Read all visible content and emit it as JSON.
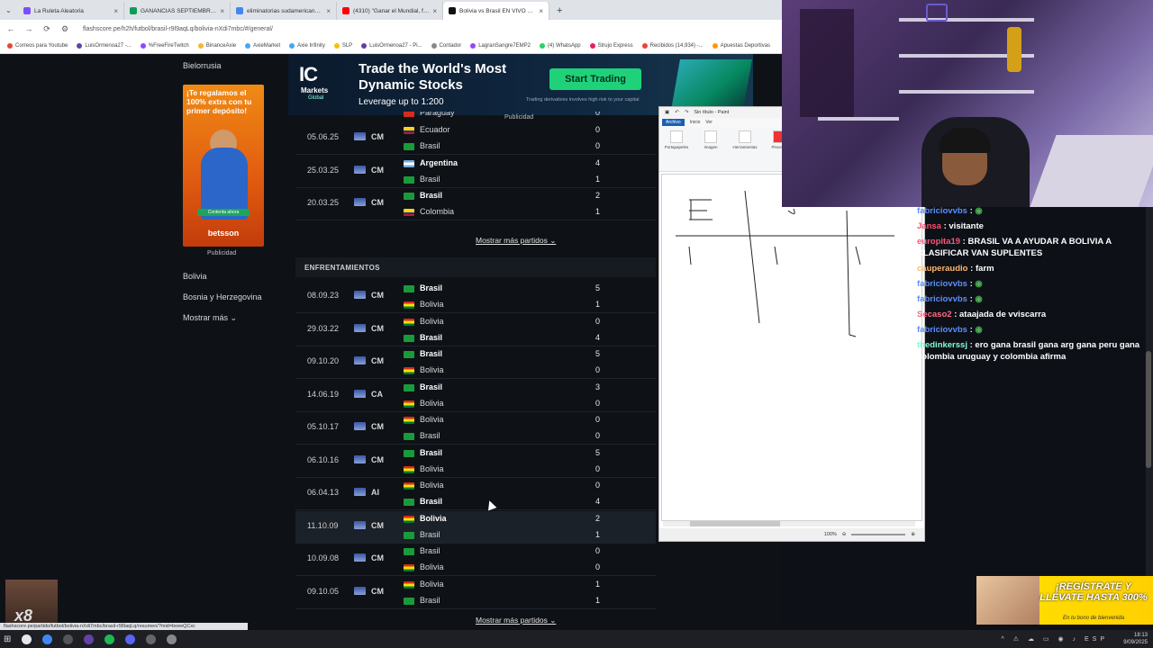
{
  "browser": {
    "tabs": [
      {
        "label": "La Ruleta Aleatoria",
        "color": "#7c4dff"
      },
      {
        "label": "GANANCIAS SEPTIEMBRE - Ho...",
        "color": "#0f9d58"
      },
      {
        "label": "eliminatorias sudamericanas -...",
        "color": "#4285f4"
      },
      {
        "label": "(4310) \"Ganar el Mundial, fina...",
        "color": "#ff0000"
      },
      {
        "label": "Bolivia vs Brasil EN VIVO 10/0...",
        "color": "#111111",
        "active": true
      }
    ],
    "new_tab": "+",
    "url": "flashscore.pe/h2h/futbol/brasil-r9l9aqLq/bolivia-nXdi7mbc/#/general/",
    "bookmarks": [
      "Correos para Youtube",
      "LuisOrmenoa27 -...",
      "%FreeFireTwitch",
      "BinanceAxie",
      "AxieMarket",
      "Axie Infinity",
      "SLP",
      "LuisOrmenoa27 - Pi...",
      "Contador",
      "LagranSangre7EMP2",
      "(4) WhatsApp",
      "Strujo Express",
      "Recibidos (14,934) -...",
      "Apuestas Deportivas"
    ]
  },
  "sidebar": {
    "top_link": "Bielorrusia",
    "promo_text": "¡Te regalamos el 100% extra con tu primer depósito!",
    "promo_brand": "betsson",
    "promo_cta": "Contenta ahora",
    "pub_label": "Publicidad",
    "links": [
      "Bolivia",
      "Bosnia y Herzegovina"
    ],
    "more": "Mostrar más"
  },
  "ad": {
    "logo": "IC",
    "logo_sub": "Markets",
    "logo_sub2": "Global",
    "headline": "Trade the World's Most Dynamic Stocks",
    "subline": "Leverage up to 1:200",
    "cta": "Start Trading",
    "risk": "Trading derivatives involves high risk to your capital",
    "pub_label": "Publicidad"
  },
  "matches_top": [
    {
      "date": "",
      "comp": "",
      "home": "Paraguay",
      "away": "",
      "hs": "0",
      "as": "",
      "partial": true
    },
    {
      "date": "05.06.25",
      "comp": "CM",
      "home": "Ecuador",
      "home_flag": "ecu",
      "away": "Brasil",
      "away_flag": "bra",
      "hs": "0",
      "as": "0",
      "winner": ""
    },
    {
      "date": "25.03.25",
      "comp": "CM",
      "home": "Argentina",
      "home_flag": "arg",
      "away": "Brasil",
      "away_flag": "bra",
      "hs": "4",
      "as": "1",
      "winner": "home"
    },
    {
      "date": "20.03.25",
      "comp": "CM",
      "home": "Brasil",
      "home_flag": "bra",
      "away": "Colombia",
      "away_flag": "col",
      "hs": "2",
      "as": "1",
      "winner": "home"
    }
  ],
  "more_matches": "Mostrar más partidos",
  "section_title": "ENFRENTAMIENTOS",
  "h2h": [
    {
      "date": "08.09.23",
      "comp": "CM",
      "home": "Brasil",
      "home_flag": "bra",
      "away": "Bolivia",
      "away_flag": "bol",
      "hs": "5",
      "as": "1",
      "winner": "home"
    },
    {
      "date": "29.03.22",
      "comp": "CM",
      "home": "Bolivia",
      "home_flag": "bol",
      "away": "Brasil",
      "away_flag": "bra",
      "hs": "0",
      "as": "4",
      "winner": "away"
    },
    {
      "date": "09.10.20",
      "comp": "CM",
      "home": "Brasil",
      "home_flag": "bra",
      "away": "Bolivia",
      "away_flag": "bol",
      "hs": "5",
      "as": "0",
      "winner": "home"
    },
    {
      "date": "14.06.19",
      "comp": "CA",
      "home": "Brasil",
      "home_flag": "bra",
      "away": "Bolivia",
      "away_flag": "bol",
      "hs": "3",
      "as": "0",
      "winner": "home"
    },
    {
      "date": "05.10.17",
      "comp": "CM",
      "home": "Bolivia",
      "home_flag": "bol",
      "away": "Brasil",
      "away_flag": "bra",
      "hs": "0",
      "as": "0",
      "winner": ""
    },
    {
      "date": "06.10.16",
      "comp": "CM",
      "home": "Brasil",
      "home_flag": "bra",
      "away": "Bolivia",
      "away_flag": "bol",
      "hs": "5",
      "as": "0",
      "winner": "home"
    },
    {
      "date": "06.04.13",
      "comp": "AI",
      "home": "Bolivia",
      "home_flag": "bol",
      "away": "Brasil",
      "away_flag": "bra",
      "hs": "0",
      "as": "4",
      "winner": "away"
    },
    {
      "date": "11.10.09",
      "comp": "CM",
      "home": "Bolivia",
      "home_flag": "bol",
      "away": "Brasil",
      "away_flag": "bra",
      "hs": "2",
      "as": "1",
      "winner": "home",
      "highlight": true
    },
    {
      "date": "10.09.08",
      "comp": "CM",
      "home": "Brasil",
      "home_flag": "bra",
      "away": "Bolivia",
      "away_flag": "bol",
      "hs": "0",
      "as": "0",
      "winner": ""
    },
    {
      "date": "09.10.05",
      "comp": "CM",
      "home": "Bolivia",
      "home_flag": "bol",
      "away": "Brasil",
      "away_flag": "bra",
      "hs": "1",
      "as": "1",
      "winner": ""
    }
  ],
  "paint": {
    "title": "Sin título - Paint",
    "tabs": [
      "Archivo",
      "Inicio",
      "Ver"
    ],
    "groups": [
      "Portapapeles",
      "Imagen",
      "Herramientas",
      "Pinceles",
      "Formas"
    ],
    "zoom": "100%"
  },
  "chat": [
    {
      "user": "fabriciovvbs",
      "color": "#5b8cff",
      "text": "",
      "emote": true
    },
    {
      "user": "Jansa",
      "color": "#ff4d6d",
      "text": "visitante"
    },
    {
      "user": "europita19",
      "color": "#ff5577",
      "text": "BRASIL VA A AYUDAR A BOLIVIA A CLASIFICAR VAN SUPLENTES"
    },
    {
      "user": "cauperaudio",
      "color": "#ffb86b",
      "text": "farm"
    },
    {
      "user": "fabriciovvbs",
      "color": "#5b8cff",
      "text": "",
      "emote": true
    },
    {
      "user": "fabriciovvbs",
      "color": "#5b8cff",
      "text": "",
      "emote": true
    },
    {
      "user": "Secaso2",
      "color": "#ff6b81",
      "text": "ataajada de vviscarra"
    },
    {
      "user": "fabriciovvbs",
      "color": "#5b8cff",
      "text": "",
      "emote": true
    },
    {
      "user": "thedinkerssj",
      "color": "#7fffd4",
      "text": "ero gana brasil gana arg gana peru gana colombia uruguay y colombia afirma"
    }
  ],
  "overlay": {
    "promo2_line1": "¡REGÍSTRATE Y LLÉVATE HASTA 300%",
    "promo2_line2": "En tu bono de bienvenida",
    "sticker": "x8"
  },
  "status_url": "flashscore.pe/partido/futbol/bolivia-nXdi7mbc/brasil-r9l9aqLq/resumen/?mid=boeeQCxc",
  "tray": {
    "lang": "ESP",
    "time": "18:13",
    "date": "9/09/2025"
  },
  "flags": {
    "bra": "#1a9b3b",
    "bol": "#d52b1e",
    "ecu": "#ffd100",
    "arg": "#74acdf",
    "col": "#fcd116",
    "par": "#d52b1e"
  }
}
